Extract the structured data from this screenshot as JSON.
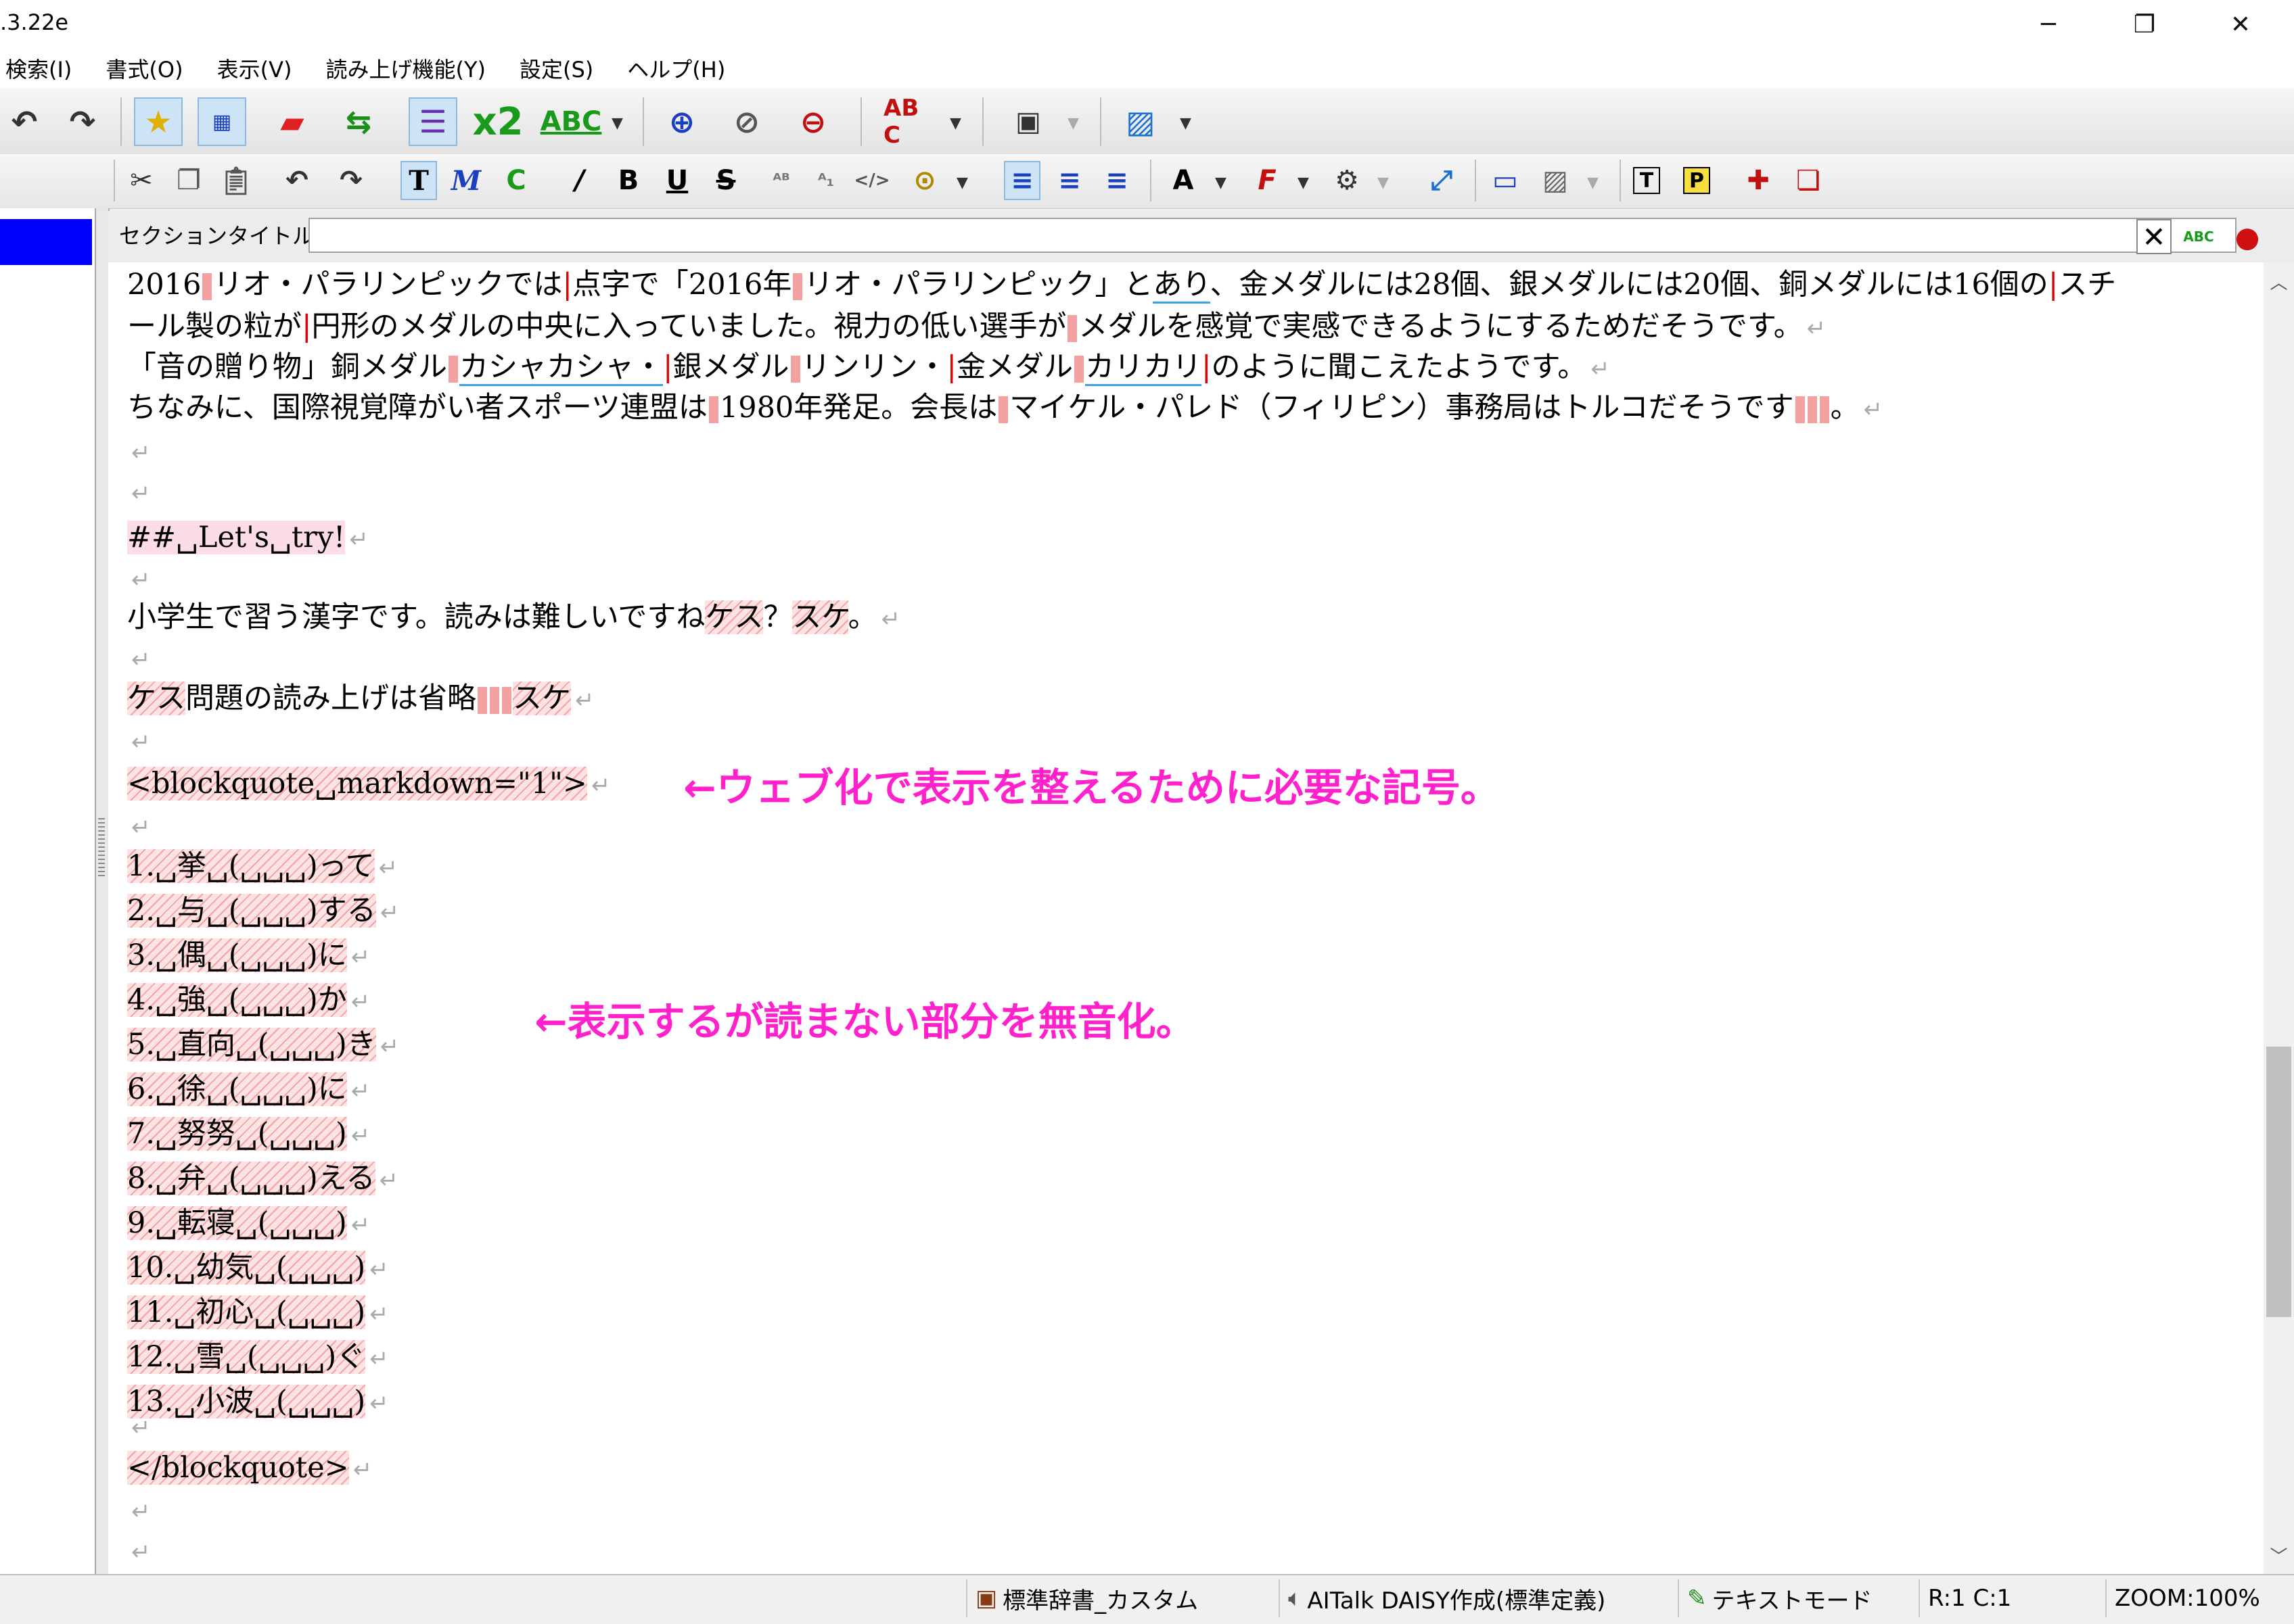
{
  "window": {
    "title": ".3.22e",
    "minimize": "─",
    "maximize": "❐",
    "close": "✕"
  },
  "menu": [
    "検索(I)",
    "書式(O)",
    "表示(V)",
    "読み上げ機能(Y)",
    "設定(S)",
    "ヘルプ(H)"
  ],
  "toolbar1": {
    "x2_label": "x2",
    "abc_label": "ABC",
    "abc_spell_label": "AB C"
  },
  "toolbar2": {
    "t_label": "T",
    "m_label": "M",
    "c_label": "C",
    "italic_label": "/",
    "bold_label": "B",
    "underline_label": "U",
    "strike_label": "S",
    "text_t_label": "T",
    "text_p_label": "P"
  },
  "section": {
    "label": "セクションタイトル",
    "value": ""
  },
  "editor": {
    "l1": {
      "a": "2016",
      "b": "リオ・パラリンピックでは",
      "c": "点字で「2016年",
      "d": "リオ・パラリンピック」と",
      "e": "あり",
      "f": "、金メダルには28個、銀メダルには20個、銅メダルには16個の",
      "g": "スチ"
    },
    "l2": {
      "a": "ール製の粒が",
      "b": "円形のメダルの中央に入っていました。視力の低い選手が",
      "c": "メダルを感覚で実感できるようにするためだそうです。"
    },
    "l3": {
      "a": "「音の贈り物」銅メダル",
      "b": "カシャカシャ・",
      "c": "銀メダル",
      "d": "リンリン・",
      "e": "金メダル",
      "f": "カリカリ",
      "g": "のように聞こえたようです。"
    },
    "l4": {
      "a": "ちなみに、国際視覚障がい者スポーツ連盟は",
      "b": "1980年発足。会長は",
      "c": "マイケル・パレド（フィリピン）事務局はトルコだそうです",
      "d": "。"
    },
    "heading": "##␣Let's␣try!",
    "l5": {
      "a": "小学生で習う漢字です。読みは難しいですね",
      "b": "ケス",
      "c": "？",
      "d": "スケ",
      "e": "。"
    },
    "l6": {
      "a": "ケス",
      "b": "問題の読み上げは省略",
      "c": "スケ"
    },
    "blockquote_open": "<blockquote␣markdown=\"1\">",
    "quiz": [
      {
        "q": "1.␣挙␣(␣␣␣)",
        "a": "って"
      },
      {
        "q": "2.␣与␣(␣␣␣)",
        "a": "する"
      },
      {
        "q": "3.␣偶␣(␣␣␣)",
        "a": "に"
      },
      {
        "q": "4.␣強␣(␣␣␣)",
        "a": "か"
      },
      {
        "q": "5.␣直向␣(␣␣␣)",
        "a": "き"
      },
      {
        "q": "6.␣徐␣(␣␣␣)",
        "a": "に"
      },
      {
        "q": "7.␣努努␣(␣␣␣)",
        "a": ""
      },
      {
        "q": "8.␣弁␣(␣␣␣)",
        "a": "える"
      },
      {
        "q": "9.␣転寝␣(␣␣␣)",
        "a": ""
      },
      {
        "q": "10.␣幼気␣(␣␣␣)",
        "a": ""
      },
      {
        "q": "11.␣初心␣(␣␣␣)",
        "a": ""
      },
      {
        "q": "12.␣雪␣(␣␣␣)",
        "a": "ぐ"
      },
      {
        "q": "13.␣小波␣(␣␣␣)",
        "a": ""
      }
    ],
    "blockquote_close": "</blockquote>",
    "return_mark": "↵"
  },
  "annotations": {
    "markup": "←ウェブ化で表示を整えるために必要な記号。",
    "silence": "←表示するが読まない部分を無音化。"
  },
  "statusbar": {
    "dictionary": "標準辞書_カスタム",
    "voice": "AITalk DAISY作成(標準定義)",
    "mode": "テキストモード",
    "position": "R:1 C:1",
    "zoom": "ZOOM:100%"
  },
  "colors": {
    "annotation": "#ff22cc",
    "silenced": "#f3a3a3",
    "selection": "#0000ff"
  }
}
